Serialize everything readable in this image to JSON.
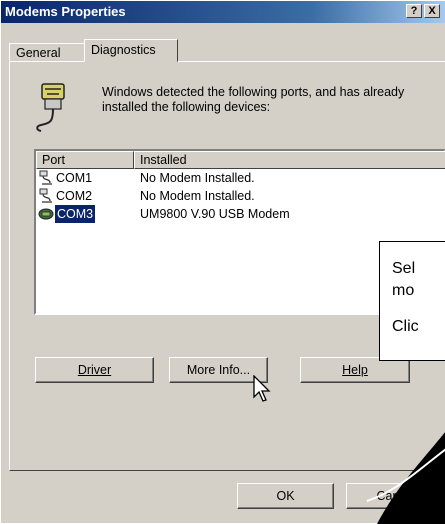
{
  "window": {
    "title": "Modems Properties",
    "help_btn": "?",
    "close_btn": "X"
  },
  "tabs": [
    "General",
    "Diagnostics"
  ],
  "diagnostics": {
    "message": "Windows detected the following ports, and has already installed the following devices:",
    "columns": [
      "Port",
      "Installed"
    ],
    "rows": [
      {
        "port": "COM1",
        "installed": "No Modem Installed."
      },
      {
        "port": "COM2",
        "installed": "No Modem Installed."
      },
      {
        "port": "COM3",
        "installed": "UM9800 V.90 USB Modem",
        "selected": true
      }
    ],
    "buttons": {
      "driver": "Driver",
      "more_info": "More Info...",
      "help": "Help"
    }
  },
  "footer": {
    "ok": "OK",
    "cancel": "Cancel"
  },
  "callout": {
    "line1": "Sel",
    "line2": "mo",
    "line3": "Clic"
  }
}
